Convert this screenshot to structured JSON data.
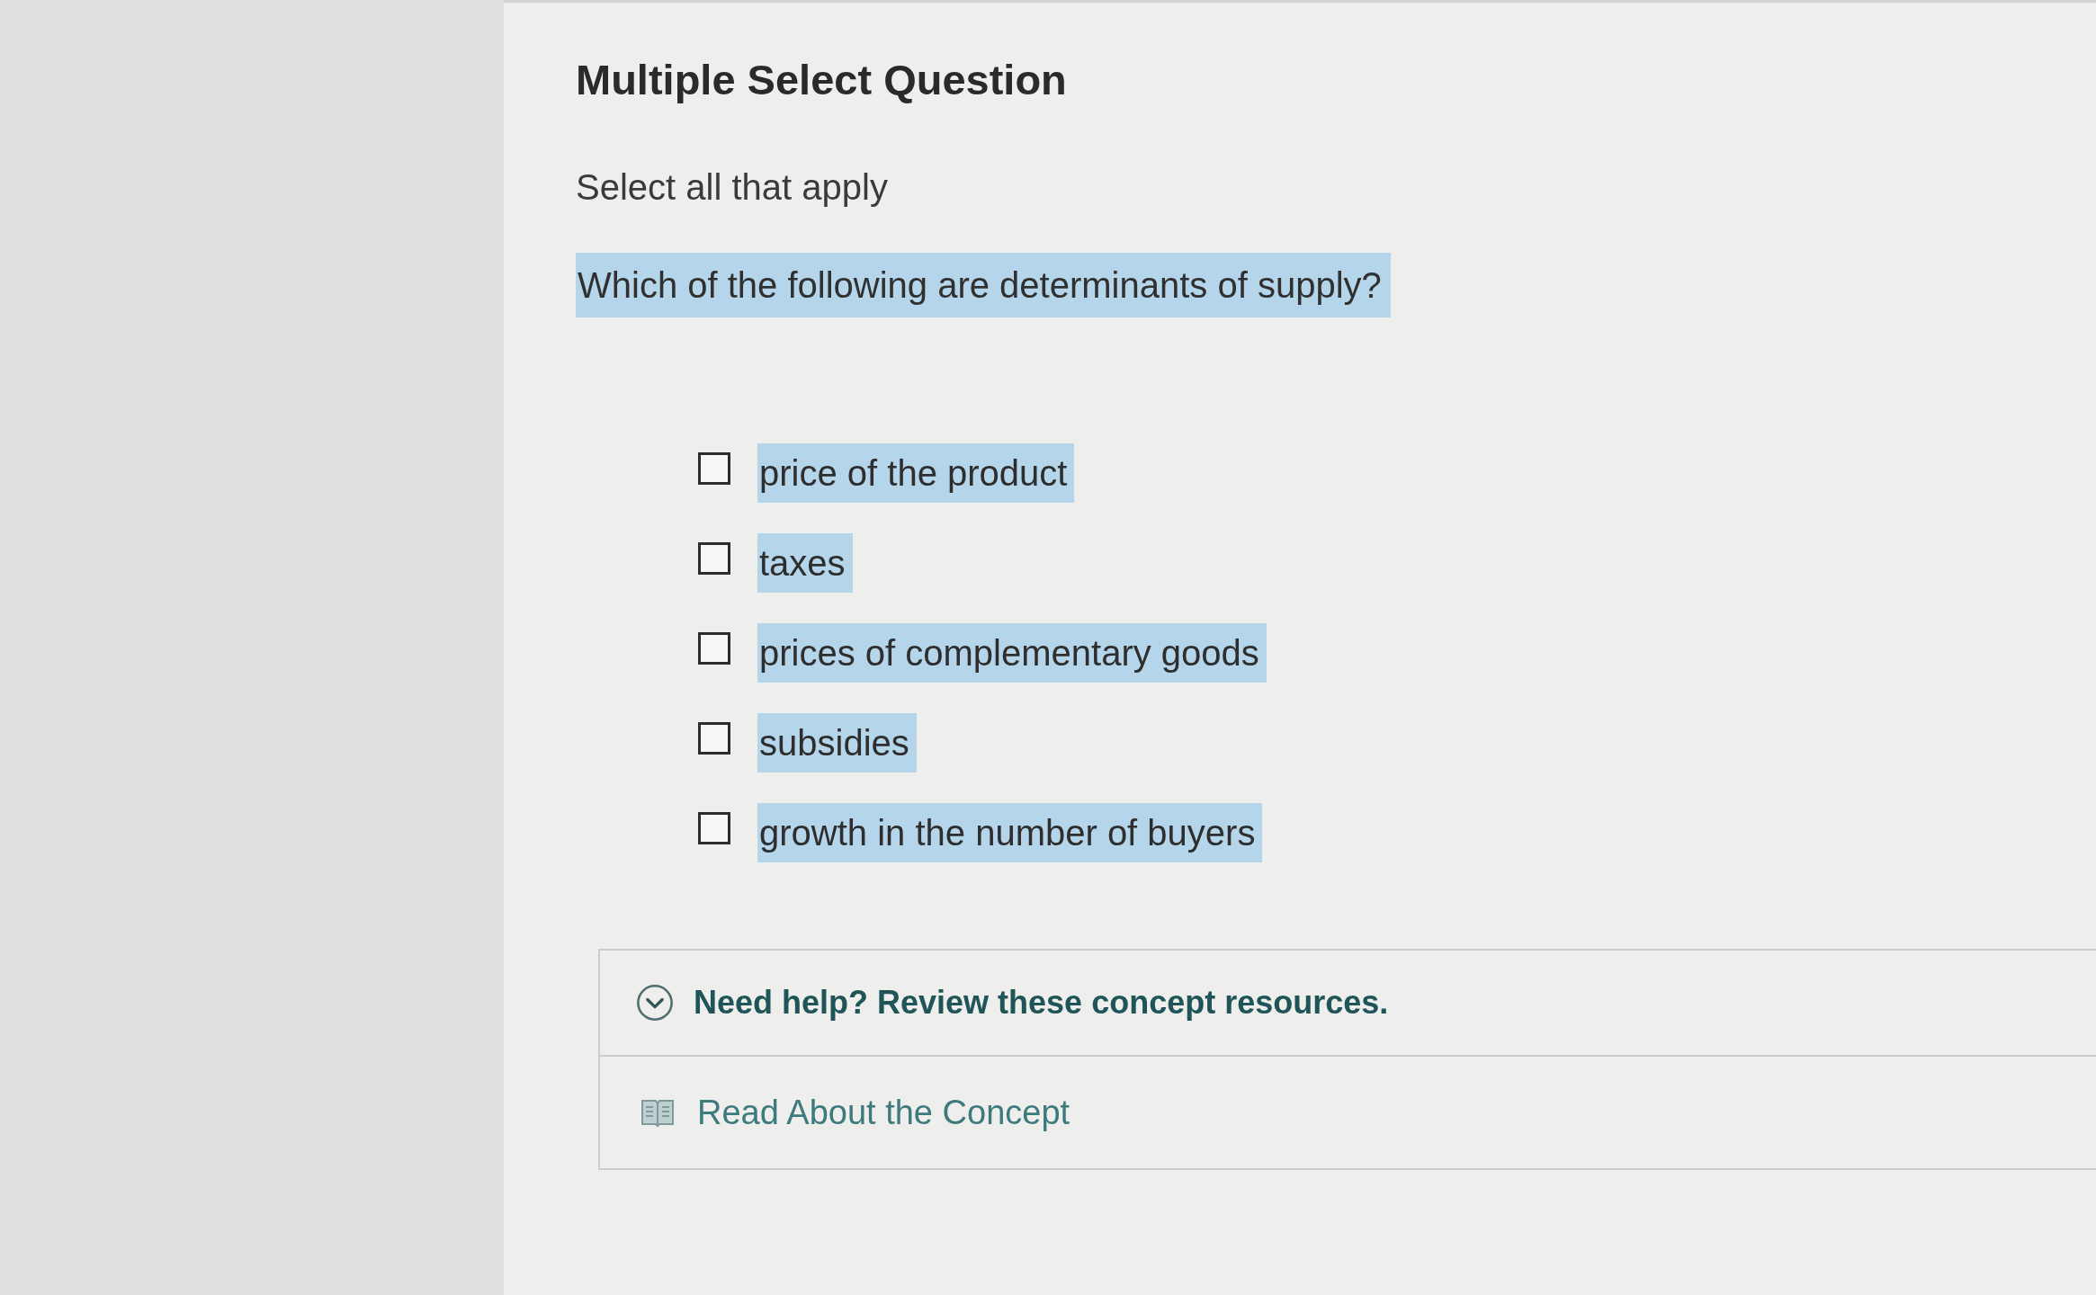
{
  "question": {
    "type_label": "Multiple Select Question",
    "instruction": "Select all that apply",
    "prompt": {
      "text": "Which of the following are determinants of supply?",
      "highlighted": true
    }
  },
  "options": [
    {
      "label": "price of the product",
      "checked": false,
      "highlighted": true
    },
    {
      "label": "taxes",
      "checked": false,
      "highlighted": true
    },
    {
      "label": "prices of complementary goods",
      "checked": false,
      "highlighted": true
    },
    {
      "label": "subsidies",
      "checked": false,
      "highlighted": true
    },
    {
      "label": "growth in the number of buyers",
      "checked": false,
      "highlighted": true
    }
  ],
  "help": {
    "title": "Need help? Review these concept resources.",
    "expanded": true,
    "resources": [
      {
        "label": "Read About the Concept"
      }
    ]
  }
}
